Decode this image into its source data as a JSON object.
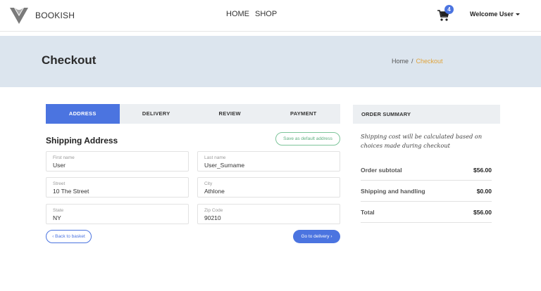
{
  "brand": {
    "name": "BOOKISH"
  },
  "nav": {
    "items": [
      "HOME",
      "SHOP"
    ]
  },
  "cart": {
    "count": "4"
  },
  "user": {
    "label": "Welcome User"
  },
  "hero": {
    "title": "Checkout",
    "breadcrumb": [
      "Home",
      "/",
      "Checkout"
    ]
  },
  "steps": [
    "ADDRESS",
    "DELIVERY",
    "REVIEW",
    "PAYMENT"
  ],
  "shipping": {
    "title": "Shipping Address",
    "save_default_label": "Save as default address",
    "fields": [
      {
        "label": "First name",
        "value": "User"
      },
      {
        "label": "Last name",
        "value": "User_Surname"
      },
      {
        "label": "Street",
        "value": "10 The Street"
      },
      {
        "label": "City",
        "value": "Athlone"
      },
      {
        "label": "State",
        "value": "NY"
      },
      {
        "label": "Zip Code",
        "value": "90210"
      }
    ],
    "back_label": "‹ Back to basket",
    "next_label": "Go to delivery ›"
  },
  "summary": {
    "title": "ORDER SUMMARY",
    "note": "Shipping cost will be calculated based on choices made during checkout",
    "rows": [
      {
        "label": "Order subtotal",
        "value": "$56.00"
      },
      {
        "label": "Shipping and handling",
        "value": "$0.00"
      },
      {
        "label": "Total",
        "value": "$56.00"
      }
    ]
  },
  "colors": {
    "accent": "#4b74e0",
    "hero_bg": "#dce5ee",
    "breadcrumb_active": "#e0a43c",
    "success": "#5fae7f"
  }
}
